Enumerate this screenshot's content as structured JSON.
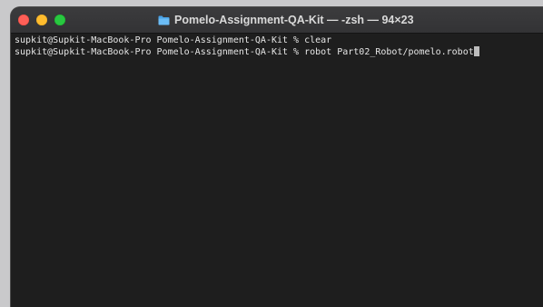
{
  "window": {
    "title": "Pomelo-Assignment-QA-Kit — -zsh — 94×23",
    "title_icon": "folder-icon",
    "traffic_lights": {
      "close": "#ff5f57",
      "minimize": "#febc2e",
      "zoom": "#28c840"
    }
  },
  "terminal": {
    "background": "#1e1e1e",
    "lines": [
      {
        "prompt": "supkit@Supkit-MacBook-Pro Pomelo-Assignment-QA-Kit % ",
        "command": "clear"
      },
      {
        "prompt": "supkit@Supkit-MacBook-Pro Pomelo-Assignment-QA-Kit % ",
        "command": "robot Part02_Robot/pomelo.robot"
      }
    ]
  }
}
